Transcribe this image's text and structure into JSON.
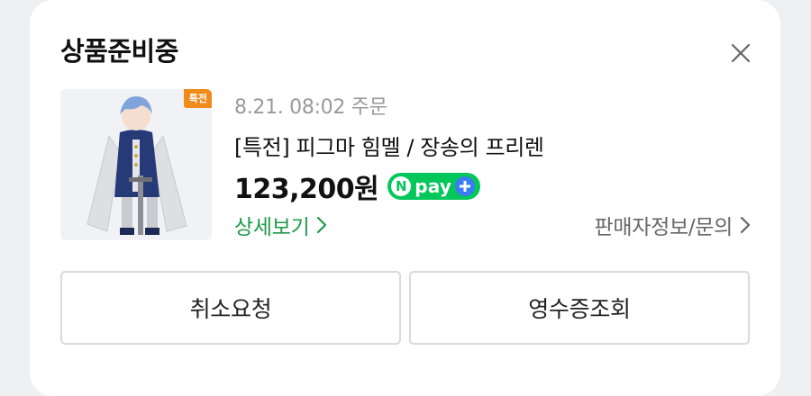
{
  "order": {
    "status": "상품준비중",
    "date": "8.21. 08:02 주문",
    "product_title": "[특전] 피그마 힘멜 / 장송의 프리렌",
    "price": "123,200원",
    "thumbnail_badge": "특전"
  },
  "npay": {
    "n": "N",
    "text": "pay",
    "plus_icon": "plus-icon",
    "brand_color": "#03c75a",
    "plus_color": "#3b7cf6"
  },
  "links": {
    "detail": "상세보기",
    "seller": "판매자정보/문의"
  },
  "buttons": {
    "cancel": "취소요청",
    "receipt": "영수증조회"
  },
  "icons": {
    "close": "close-icon",
    "chevron": "chevron-right-icon"
  },
  "colors": {
    "accent_green": "#1f9a4a",
    "badge_orange": "#f08a1a"
  }
}
